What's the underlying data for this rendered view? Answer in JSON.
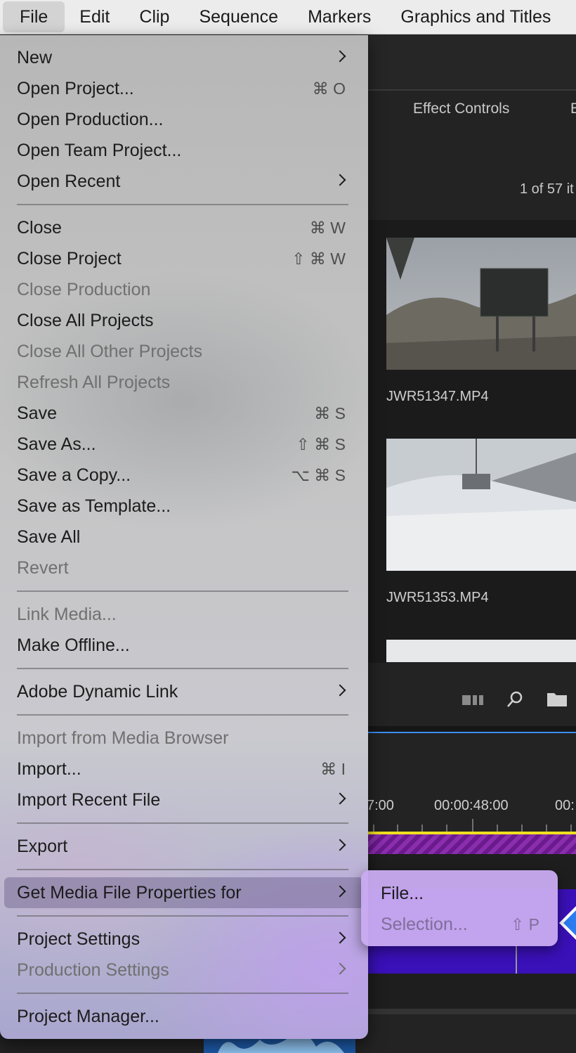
{
  "menubar": {
    "items": [
      "File",
      "Edit",
      "Clip",
      "Sequence",
      "Markers",
      "Graphics and Titles"
    ]
  },
  "background": {
    "tab_effect_controls": "Effect Controls",
    "tab_partial": "E",
    "item_count": "1 of 57 it",
    "clips": [
      {
        "name": "JWR51347.MP4"
      },
      {
        "name": "JWR51353.MP4"
      }
    ],
    "timecodes": [
      "7:00",
      "00:00:48:00",
      "00:"
    ],
    "colors": {
      "timeline_purple": "#6a1a8c",
      "track_blue": "#3a10b8",
      "playhead_yellow": "#f0e020",
      "accent_blue": "#3d8df5"
    }
  },
  "file_menu": {
    "new": {
      "label": "New"
    },
    "open_project": {
      "label": "Open Project...",
      "shortcut": "⌘ O"
    },
    "open_production": {
      "label": "Open Production..."
    },
    "open_team_project": {
      "label": "Open Team Project..."
    },
    "open_recent": {
      "label": "Open Recent"
    },
    "close": {
      "label": "Close",
      "shortcut": "⌘ W"
    },
    "close_project": {
      "label": "Close Project",
      "shortcut": "⇧ ⌘ W"
    },
    "close_production": {
      "label": "Close Production"
    },
    "close_all_projects": {
      "label": "Close All Projects"
    },
    "close_all_other_projects": {
      "label": "Close All Other Projects"
    },
    "refresh_all_projects": {
      "label": "Refresh All Projects"
    },
    "save": {
      "label": "Save",
      "shortcut": "⌘ S"
    },
    "save_as": {
      "label": "Save As...",
      "shortcut": "⇧ ⌘ S"
    },
    "save_a_copy": {
      "label": "Save a Copy...",
      "shortcut": "⌥ ⌘ S"
    },
    "save_as_template": {
      "label": "Save as Template..."
    },
    "save_all": {
      "label": "Save All"
    },
    "revert": {
      "label": "Revert"
    },
    "link_media": {
      "label": "Link Media..."
    },
    "make_offline": {
      "label": "Make Offline..."
    },
    "adobe_dynamic_link": {
      "label": "Adobe Dynamic Link"
    },
    "import_from_media_browser": {
      "label": "Import from Media Browser"
    },
    "import": {
      "label": "Import...",
      "shortcut": "⌘ I"
    },
    "import_recent_file": {
      "label": "Import Recent File"
    },
    "export": {
      "label": "Export"
    },
    "get_media_file_properties": {
      "label": "Get Media File Properties for"
    },
    "project_settings": {
      "label": "Project Settings"
    },
    "production_settings": {
      "label": "Production Settings"
    },
    "project_manager": {
      "label": "Project Manager..."
    }
  },
  "submenu": {
    "file": {
      "label": "File..."
    },
    "selection": {
      "label": "Selection...",
      "shortcut": "⇧ P"
    }
  }
}
